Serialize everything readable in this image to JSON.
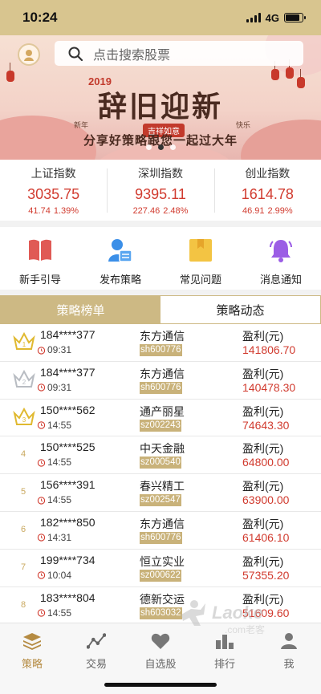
{
  "status_bar": {
    "time": "10:24",
    "network": "4G",
    "battery_level": 0.85
  },
  "search": {
    "placeholder": "点击搜索股票"
  },
  "banner": {
    "year": "2019",
    "title": "辞旧迎新",
    "badge": "吉祥如意",
    "left_side": "新年",
    "right_side": "快乐",
    "subtitle": "分享好策略跟您一起过大年",
    "slides": 3,
    "active_slide": 2
  },
  "indices": [
    {
      "name": "上证指数",
      "value": "3035.75",
      "change": "41.74",
      "percent": "1.39%"
    },
    {
      "name": "深圳指数",
      "value": "9395.11",
      "change": "227.46",
      "percent": "2.48%"
    },
    {
      "name": "创业指数",
      "value": "1614.78",
      "change": "46.91",
      "percent": "2.99%"
    }
  ],
  "quicklinks": [
    {
      "label": "新手引导",
      "icon": "book-icon",
      "color": "#e05a55"
    },
    {
      "label": "发布策略",
      "icon": "user-card-icon",
      "color": "#3b8fe8"
    },
    {
      "label": "常见问题",
      "icon": "folder-icon",
      "color": "#f3c443"
    },
    {
      "label": "消息通知",
      "icon": "bell-icon",
      "color": "#9b5de5"
    }
  ],
  "tabs": [
    {
      "label": "策略榜单",
      "active": true
    },
    {
      "label": "策略动态",
      "active": false
    }
  ],
  "rankings": [
    {
      "rank": "1",
      "user": "184****377",
      "time": "09:31",
      "stock": "东方通信",
      "code": "sh600776",
      "profit_label": "盈利(元)",
      "profit": "141806.70"
    },
    {
      "rank": "2",
      "user": "184****377",
      "time": "09:31",
      "stock": "东方通信",
      "code": "sh600776",
      "profit_label": "盈利(元)",
      "profit": "140478.30"
    },
    {
      "rank": "3",
      "user": "150****562",
      "time": "14:55",
      "stock": "通产丽星",
      "code": "sz002243",
      "profit_label": "盈利(元)",
      "profit": "74643.30"
    },
    {
      "rank": "4",
      "user": "150****525",
      "time": "14:55",
      "stock": "中天金融",
      "code": "sz000540",
      "profit_label": "盈利(元)",
      "profit": "64800.00"
    },
    {
      "rank": "5",
      "user": "156****391",
      "time": "14:55",
      "stock": "春兴精工",
      "code": "sz002547",
      "profit_label": "盈利(元)",
      "profit": "63900.00"
    },
    {
      "rank": "6",
      "user": "182****850",
      "time": "14:31",
      "stock": "东方通信",
      "code": "sh600776",
      "profit_label": "盈利(元)",
      "profit": "61406.10"
    },
    {
      "rank": "7",
      "user": "199****734",
      "time": "10:04",
      "stock": "恒立实业",
      "code": "sz000622",
      "profit_label": "盈利(元)",
      "profit": "57355.20"
    },
    {
      "rank": "8",
      "user": "183****804",
      "time": "14:55",
      "stock": "德新交运",
      "code": "sh603032",
      "profit_label": "盈利(元)",
      "profit": "51609.60"
    }
  ],
  "watermark": {
    "text": "Laoke",
    "sub": ".com老客"
  },
  "bottom_nav": [
    {
      "label": "策略",
      "icon": "stack-icon",
      "active": true
    },
    {
      "label": "交易",
      "icon": "trend-icon",
      "active": false
    },
    {
      "label": "自选股",
      "icon": "heart-icon",
      "active": false
    },
    {
      "label": "排行",
      "icon": "ranking-icon",
      "active": false
    },
    {
      "label": "我",
      "icon": "person-icon",
      "active": false
    }
  ],
  "colors": {
    "gold": "#cdb984",
    "red": "#d13b2f",
    "nav_active": "#b58b42"
  }
}
